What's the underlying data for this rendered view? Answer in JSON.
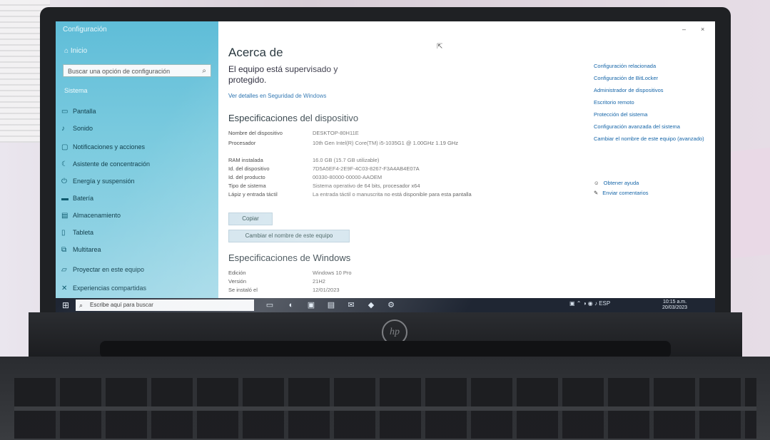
{
  "window": {
    "title": "Configuración",
    "home_label": "Inicio",
    "controls": {
      "minimize": "–",
      "close": "×"
    }
  },
  "sidebar": {
    "search_placeholder": "Buscar una opción de configuración",
    "section_label": "Sistema",
    "items": [
      {
        "label": "Pantalla",
        "icon": "monitor-icon"
      },
      {
        "label": "Sonido",
        "icon": "speaker-icon"
      },
      {
        "label": "Notificaciones y acciones",
        "icon": "notifications-icon"
      },
      {
        "label": "Asistente de concentración",
        "icon": "moon-icon"
      },
      {
        "label": "Energía y suspensión",
        "icon": "power-icon"
      },
      {
        "label": "Batería",
        "icon": "battery-icon"
      },
      {
        "label": "Almacenamiento",
        "icon": "storage-icon"
      },
      {
        "label": "Tableta",
        "icon": "tablet-icon"
      },
      {
        "label": "Multitarea",
        "icon": "multitask-icon"
      },
      {
        "label": "Proyectar en este equipo",
        "icon": "project-icon"
      },
      {
        "label": "Experiencias compartidas",
        "icon": "share-icon"
      }
    ]
  },
  "content": {
    "title": "Acerca de",
    "protection_text": "El equipo está supervisado y protegido.",
    "security_link": "Ver detalles en Seguridad de Windows",
    "device_specs_heading": "Especificaciones del dispositivo",
    "device_specs": [
      {
        "key": "Nombre del dispositivo",
        "value": "DESKTOP-80H11E"
      },
      {
        "key": "Procesador",
        "value": "10th Gen Intel(R) Core(TM) i5-1035G1 @ 1.00GHz   1.19 GHz"
      },
      {
        "key": "RAM instalada",
        "value": "16.0 GB (15.7 GB utilizable)"
      },
      {
        "key": "Id. del dispositivo",
        "value": "7D5A5EF4-2E9F-4C03-8267-F3A4AB4E07A"
      },
      {
        "key": "Id. del producto",
        "value": "00330-80000-00000-AAOEM"
      },
      {
        "key": "Tipo de sistema",
        "value": "Sistema operativo de 64 bits, procesador x64"
      },
      {
        "key": "Lápiz y entrada táctil",
        "value": "La entrada táctil o manuscrita no está disponible para esta pantalla"
      }
    ],
    "copy_button": "Copiar",
    "rename_button": "Cambiar el nombre de este equipo",
    "windows_specs_heading": "Especificaciones de Windows",
    "windows_specs": [
      {
        "key": "Edición",
        "value": "Windows 10 Pro"
      },
      {
        "key": "Versión",
        "value": "21H2"
      },
      {
        "key": "Se instaló el",
        "value": "12/01/2023"
      }
    ]
  },
  "related": {
    "links": [
      "Configuración relacionada",
      "Configuración de BitLocker",
      "Administrador de dispositivos",
      "Escritorio remoto",
      "Protección del sistema",
      "Configuración avanzada del sistema",
      "Cambiar el nombre de este equipo (avanzado)"
    ],
    "help": [
      {
        "label": "Obtener ayuda",
        "icon": "help-icon"
      },
      {
        "label": "Enviar comentarios",
        "icon": "feedback-icon"
      }
    ]
  },
  "taskbar": {
    "search_placeholder": "Escribe aquí para buscar",
    "tray_text": "ESP",
    "clock_time": "10:15 a.m.",
    "clock_date": "20/03/2023"
  },
  "laptop": {
    "logo_text": "hp"
  }
}
